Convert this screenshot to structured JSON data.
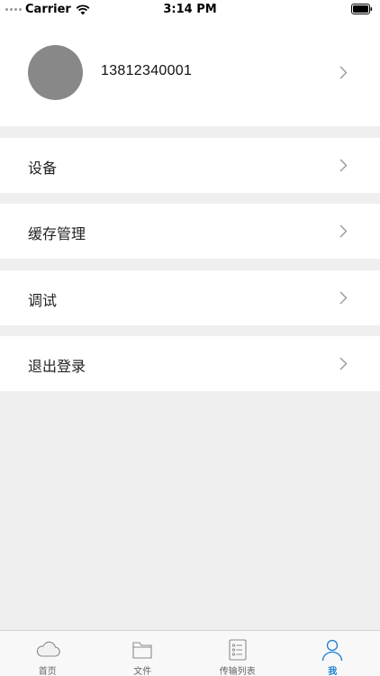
{
  "status_bar": {
    "carrier": "Carrier",
    "time": "3:14 PM"
  },
  "profile": {
    "phone": "13812340001",
    "avatar_color": "#888888"
  },
  "menu": {
    "items": [
      {
        "label": "设备"
      },
      {
        "label": "缓存管理"
      },
      {
        "label": "调试"
      },
      {
        "label": "退出登录"
      }
    ]
  },
  "tab_bar": {
    "tabs": [
      {
        "label": "首页",
        "icon": "cloud-icon"
      },
      {
        "label": "文件",
        "icon": "folder-icon"
      },
      {
        "label": "传输列表",
        "icon": "list-icon"
      },
      {
        "label": "我",
        "icon": "person-icon",
        "active": true
      }
    ],
    "active_color": "#1b7fd1",
    "inactive_color": "#666666"
  }
}
